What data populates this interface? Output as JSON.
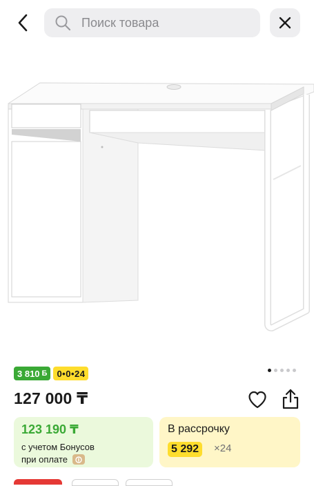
{
  "search": {
    "placeholder": "Поиск товара"
  },
  "icons": {
    "back": "chevron-left-icon",
    "search": "search-icon",
    "close": "close-icon",
    "favorite": "heart-icon",
    "share": "share-icon"
  },
  "gallery": {
    "dots_count": 5,
    "active_index": 0
  },
  "badges": {
    "bonus": "3 810",
    "bonus_unit": "Б",
    "installment": "0•0•24"
  },
  "price": "127 000 ₸",
  "bonus_card": {
    "price": "123 190 ₸",
    "line1": "с учетом Бонусов",
    "line2": "при оплате"
  },
  "installment_card": {
    "title": "В рассрочку",
    "amount": "5 292",
    "multiplier": "×24"
  },
  "colors": {
    "green": "#3aa935",
    "yellow": "#fedd2d",
    "light_green": "#ebf9dc",
    "light_yellow": "#fff6c7"
  }
}
